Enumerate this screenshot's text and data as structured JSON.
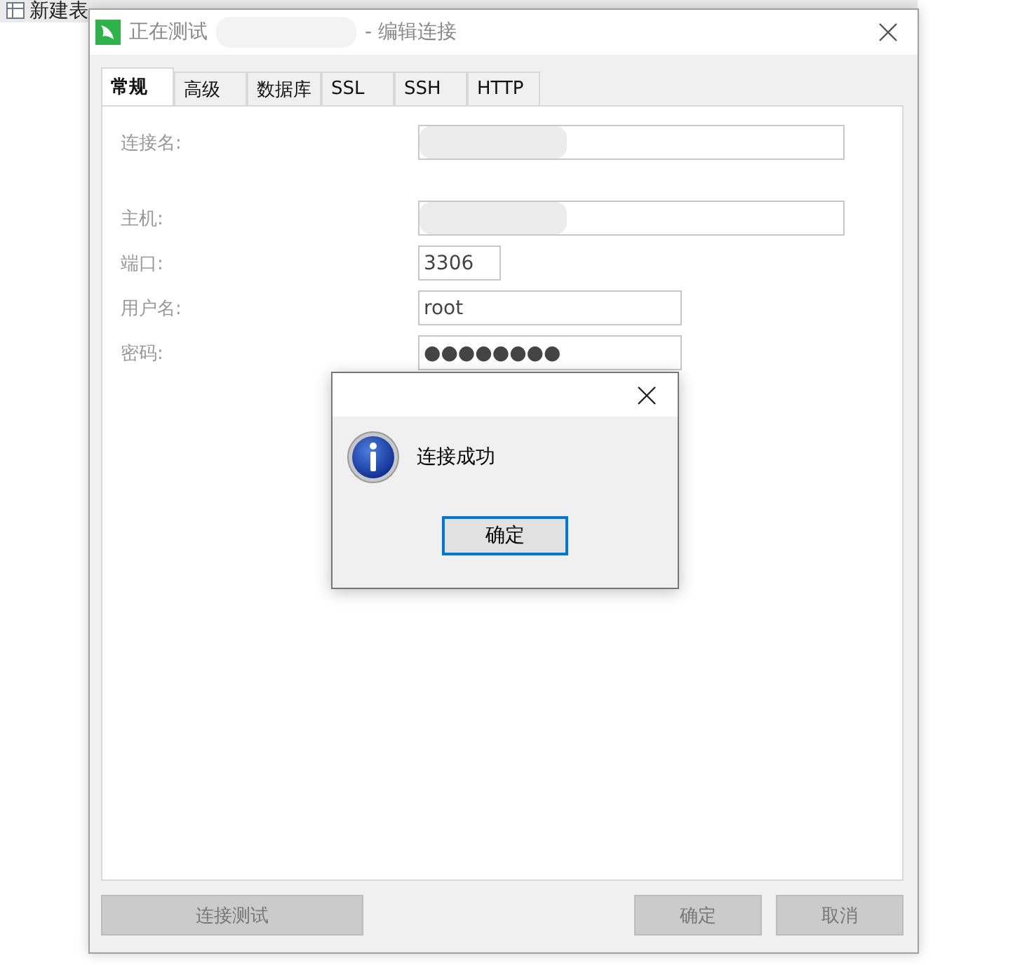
{
  "background_toolbar": {
    "items": [
      "新建表"
    ]
  },
  "window": {
    "title_prefix": "正在测试",
    "title_suffix": "- 编辑连接"
  },
  "tabs": [
    {
      "label": "常规",
      "selected": true
    },
    {
      "label": "高级",
      "selected": false
    },
    {
      "label": "数据库",
      "selected": false
    },
    {
      "label": "SSL",
      "selected": false
    },
    {
      "label": "SSH",
      "selected": false
    },
    {
      "label": "HTTP",
      "selected": false
    }
  ],
  "fields": [
    {
      "label": "连接名:",
      "kind": "wide",
      "blurred": true
    },
    {
      "label": "主机:",
      "kind": "wide",
      "blurred": true
    },
    {
      "label": "端口:",
      "kind": "short",
      "value": "3306"
    },
    {
      "label": "用户名:",
      "kind": "medium",
      "value": "root"
    },
    {
      "label": "密码:",
      "kind": "medium",
      "value": "●●●●●●●●"
    }
  ],
  "buttons": {
    "test": "连接测试",
    "ok": "确定",
    "cancel": "取消"
  },
  "message_box": {
    "message": "连接成功",
    "button": "确定"
  }
}
